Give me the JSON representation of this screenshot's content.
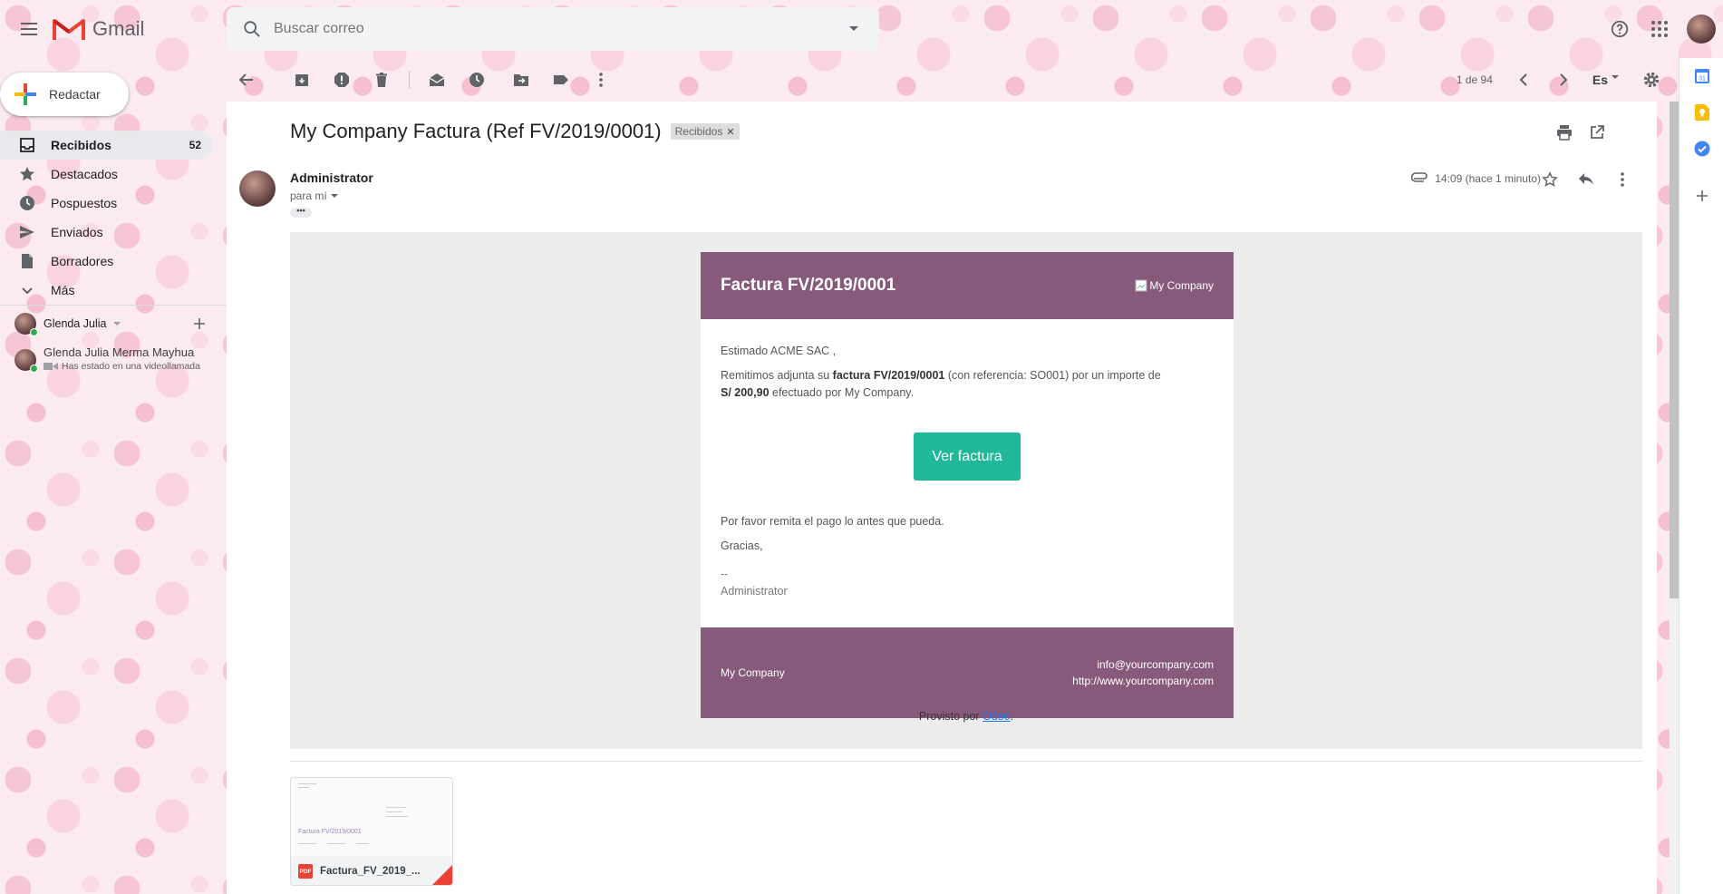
{
  "app": {
    "title": "Gmail"
  },
  "search": {
    "placeholder": "Buscar correo"
  },
  "sidebar": {
    "compose_label": "Redactar",
    "items": [
      {
        "label": "Recibidos",
        "count": "52"
      },
      {
        "label": "Destacados",
        "count": ""
      },
      {
        "label": "Pospuestos",
        "count": ""
      },
      {
        "label": "Enviados",
        "count": ""
      },
      {
        "label": "Borradores",
        "count": ""
      },
      {
        "label": "Más",
        "count": ""
      }
    ]
  },
  "hangouts": {
    "user_name": "Glenda Julia",
    "contact_name": "Glenda Julia Merma Mayhua",
    "contact_status": "Has estado en una videollamada"
  },
  "toolbar": {
    "page_count": "1 de 94",
    "language": "Es"
  },
  "email": {
    "subject": "My Company Factura (Ref FV/2019/0001)",
    "label": "Recibidos",
    "sender": "Administrator",
    "to": "para mí",
    "time": "14:09 (hace 1 minuto)"
  },
  "invoice": {
    "title": "Factura FV/2019/0001",
    "logo_alt": "My Company",
    "greeting": "Estimado ACME SAC ,",
    "p1_a": "Remitimos adjunta su ",
    "p1_b": "factura FV/2019/0001",
    "p1_c": " (con referencia: SO001) por un importe de ",
    "p1_d": "S/ 200,90",
    "p1_e": " efectuado por My Company.",
    "button": "Ver factura",
    "please_pay": "Por favor remita el pago lo antes que pueda.",
    "thanks": "Gracias,",
    "sig_dash": "--",
    "sig_name": "Administrator",
    "footer_company": "My Company",
    "footer_email": "info@yourcompany.com",
    "footer_web": "http://www.yourcompany.com",
    "provided_prefix": "Provisto por ",
    "provided_link": "Odoo",
    "provided_suffix": "."
  },
  "attachment": {
    "name": "Factura_FV_2019_...",
    "badge": "PDF",
    "preview_title": "Factura FV/2019/0001"
  },
  "colors": {
    "brand_purple": "#875a7b",
    "button_green": "#21b799",
    "gmail_red": "#ea4335",
    "link_blue": "#1a73e8"
  }
}
